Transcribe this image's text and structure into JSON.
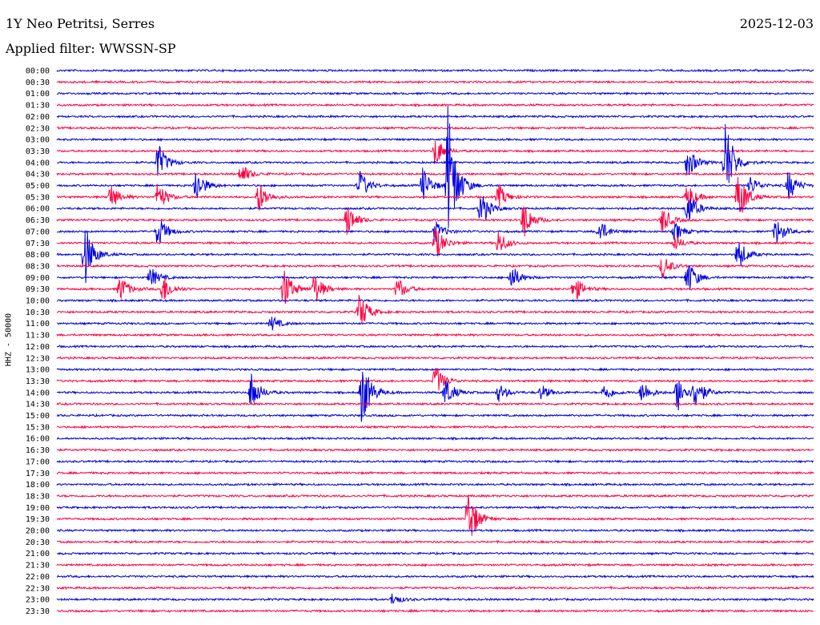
{
  "header": {
    "station": "1Y Neo Petritsi, Serres",
    "date": "2025-12-03",
    "filter": "Applied filter: WWSSN-SP"
  },
  "colors": {
    "even": "#0000dd",
    "odd": "#ff0040"
  },
  "chart_data": {
    "type": "line",
    "title": "1Y Neo Petritsi, Serres",
    "subtitle": "Applied filter: WWSSN-SP",
    "ylabel": "HHZ - 50000",
    "xlabel": "",
    "row_labels": [
      "00:00",
      "00:30",
      "01:00",
      "01:30",
      "02:00",
      "02:30",
      "03:00",
      "03:30",
      "04:00",
      "04:30",
      "05:00",
      "05:30",
      "06:00",
      "06:30",
      "07:00",
      "07:30",
      "08:00",
      "08:30",
      "09:00",
      "09:30",
      "10:00",
      "10:30",
      "11:00",
      "11:30",
      "12:00",
      "12:30",
      "13:00",
      "13:30",
      "14:00",
      "14:30",
      "15:00",
      "15:30",
      "16:00",
      "16:30",
      "17:00",
      "17:30",
      "18:00",
      "18:30",
      "19:00",
      "19:30",
      "20:00",
      "20:30",
      "21:00",
      "21:30",
      "22:00",
      "22:30",
      "23:00",
      "23:30"
    ],
    "row_minutes": 30,
    "series_colors": [
      "#0000dd",
      "#ff0040"
    ],
    "grid": false,
    "events": [
      {
        "row": 7,
        "minute": 15,
        "amp": 20
      },
      {
        "row": 8,
        "minute": 4,
        "amp": 26
      },
      {
        "row": 8,
        "minute": 25,
        "amp": 22
      },
      {
        "row": 8,
        "minute": 26.5,
        "amp": 56
      },
      {
        "row": 9,
        "minute": 7.3,
        "amp": 14
      },
      {
        "row": 10,
        "minute": 5.5,
        "amp": 24
      },
      {
        "row": 10,
        "minute": 12,
        "amp": 20
      },
      {
        "row": 10,
        "minute": 15.5,
        "amp": 100
      },
      {
        "row": 10,
        "minute": 14.5,
        "amp": 24
      },
      {
        "row": 10,
        "minute": 29,
        "amp": 20
      },
      {
        "row": 10,
        "minute": 27.5,
        "amp": 12
      },
      {
        "row": 11,
        "minute": 2.1,
        "amp": 18
      },
      {
        "row": 11,
        "minute": 8,
        "amp": 22
      },
      {
        "row": 11,
        "minute": 25,
        "amp": 18
      },
      {
        "row": 11,
        "minute": 27,
        "amp": 38
      },
      {
        "row": 11,
        "minute": 17.5,
        "amp": 16
      },
      {
        "row": 11,
        "minute": 4,
        "amp": 20
      },
      {
        "row": 12,
        "minute": 16.8,
        "amp": 24
      },
      {
        "row": 12,
        "minute": 25,
        "amp": 24
      },
      {
        "row": 13,
        "minute": 11.5,
        "amp": 22
      },
      {
        "row": 13,
        "minute": 18.5,
        "amp": 26
      },
      {
        "row": 13,
        "minute": 24,
        "amp": 18
      },
      {
        "row": 14,
        "minute": 4,
        "amp": 22
      },
      {
        "row": 14,
        "minute": 15,
        "amp": 14
      },
      {
        "row": 14,
        "minute": 21.5,
        "amp": 16
      },
      {
        "row": 14,
        "minute": 24.5,
        "amp": 12
      },
      {
        "row": 14,
        "minute": 28.5,
        "amp": 18
      },
      {
        "row": 15,
        "minute": 17.5,
        "amp": 16
      },
      {
        "row": 15,
        "minute": 15,
        "amp": 24
      },
      {
        "row": 15,
        "minute": 24.5,
        "amp": 10
      },
      {
        "row": 16,
        "minute": 1.1,
        "amp": 42
      },
      {
        "row": 16,
        "minute": 27,
        "amp": 22
      },
      {
        "row": 17,
        "minute": 24,
        "amp": 16
      },
      {
        "row": 18,
        "minute": 18,
        "amp": 18
      },
      {
        "row": 18,
        "minute": 25,
        "amp": 24
      },
      {
        "row": 18,
        "minute": 3.7,
        "amp": 14
      },
      {
        "row": 19,
        "minute": 2.5,
        "amp": 18
      },
      {
        "row": 19,
        "minute": 4.2,
        "amp": 20
      },
      {
        "row": 19,
        "minute": 9,
        "amp": 28
      },
      {
        "row": 19,
        "minute": 10.2,
        "amp": 22
      },
      {
        "row": 19,
        "minute": 13.5,
        "amp": 16
      },
      {
        "row": 19,
        "minute": 20.5,
        "amp": 18
      },
      {
        "row": 21,
        "minute": 12,
        "amp": 26
      },
      {
        "row": 22,
        "minute": 8.5,
        "amp": 10
      },
      {
        "row": 27,
        "minute": 15,
        "amp": 22
      },
      {
        "row": 28,
        "minute": 7.7,
        "amp": 26
      },
      {
        "row": 28,
        "minute": 12.1,
        "amp": 46
      },
      {
        "row": 28,
        "minute": 15.4,
        "amp": 20
      },
      {
        "row": 28,
        "minute": 17.5,
        "amp": 12
      },
      {
        "row": 28,
        "minute": 19.2,
        "amp": 10
      },
      {
        "row": 28,
        "minute": 21.7,
        "amp": 12
      },
      {
        "row": 28,
        "minute": 23.2,
        "amp": 16
      },
      {
        "row": 28,
        "minute": 24.6,
        "amp": 26
      },
      {
        "row": 28,
        "minute": 25.3,
        "amp": 22
      },
      {
        "row": 39,
        "minute": 16.3,
        "amp": 42
      },
      {
        "row": 46,
        "minute": 13.3,
        "amp": 8
      }
    ]
  }
}
